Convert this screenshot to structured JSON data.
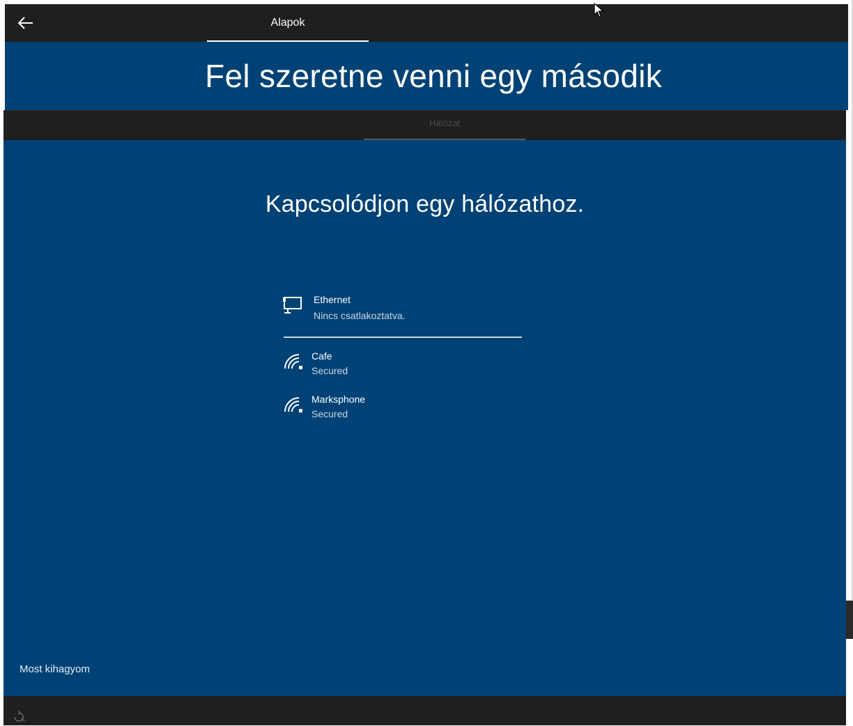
{
  "back_window": {
    "tab_label": "Alapok",
    "title": "Fel szeretne venni egy második"
  },
  "front_window": {
    "tab_label": "Hálózat",
    "title": "Kapcsolódjon egy hálózathoz.",
    "networks": [
      {
        "name": "Ethernet",
        "status": "Nincs csatlakoztatva.",
        "icon": "ethernet-icon"
      },
      {
        "name": "Cafe",
        "status": "Secured",
        "icon": "wifi-icon"
      },
      {
        "name": "Marksphone",
        "status": "Secured",
        "icon": "wifi-icon"
      }
    ],
    "skip_label": "Most kihagyom"
  },
  "colors": {
    "oobe_blue": "#004275",
    "bar_dark": "#1f1f1f"
  }
}
